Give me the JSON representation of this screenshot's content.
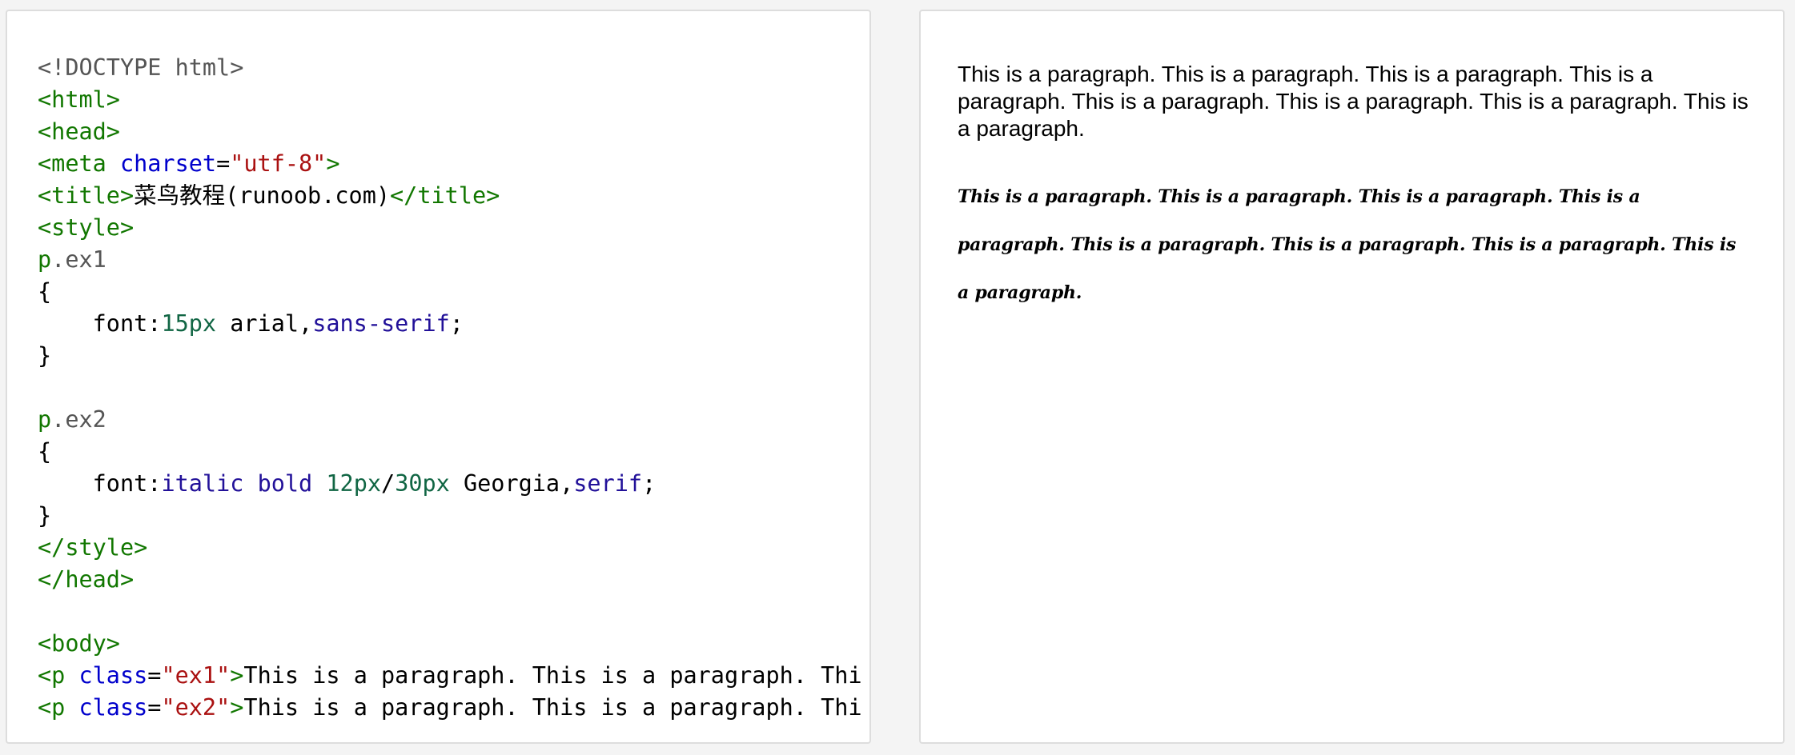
{
  "code_editor": {
    "lines": [
      [
        {
          "c": "d",
          "t": "<!DOCTYPE html>"
        }
      ],
      [
        {
          "c": "t",
          "t": "<html>"
        }
      ],
      [
        {
          "c": "t",
          "t": "<head>"
        }
      ],
      [
        {
          "c": "t",
          "t": "<meta "
        },
        {
          "c": "a",
          "t": "charset"
        },
        {
          "c": "x",
          "t": "="
        },
        {
          "c": "s",
          "t": "\"utf-8\""
        },
        {
          "c": "t",
          "t": ">"
        }
      ],
      [
        {
          "c": "t",
          "t": "<title>"
        },
        {
          "c": "x",
          "t": "菜鸟教程(runoob.com)"
        },
        {
          "c": "t",
          "t": "</title>"
        }
      ],
      [
        {
          "c": "t",
          "t": "<style>"
        }
      ],
      [
        {
          "c": "t",
          "t": "p"
        },
        {
          "c": "p",
          "t": ".ex1"
        }
      ],
      [
        {
          "c": "x",
          "t": "{"
        }
      ],
      [
        {
          "c": "x",
          "t": "    font:"
        },
        {
          "c": "n",
          "t": "15px"
        },
        {
          "c": "x",
          "t": " arial,"
        },
        {
          "c": "k",
          "t": "sans-serif"
        },
        {
          "c": "x",
          "t": ";"
        }
      ],
      [
        {
          "c": "x",
          "t": "}"
        }
      ],
      [],
      [
        {
          "c": "t",
          "t": "p"
        },
        {
          "c": "p",
          "t": ".ex2"
        }
      ],
      [
        {
          "c": "x",
          "t": "{"
        }
      ],
      [
        {
          "c": "x",
          "t": "    font:"
        },
        {
          "c": "k",
          "t": "italic"
        },
        {
          "c": "x",
          "t": " "
        },
        {
          "c": "k",
          "t": "bold"
        },
        {
          "c": "x",
          "t": " "
        },
        {
          "c": "n",
          "t": "12px"
        },
        {
          "c": "x",
          "t": "/"
        },
        {
          "c": "n",
          "t": "30px"
        },
        {
          "c": "x",
          "t": " Georgia,"
        },
        {
          "c": "k",
          "t": "serif"
        },
        {
          "c": "x",
          "t": ";"
        }
      ],
      [
        {
          "c": "x",
          "t": "}"
        }
      ],
      [
        {
          "c": "t",
          "t": "</style>"
        }
      ],
      [
        {
          "c": "t",
          "t": "</head>"
        }
      ],
      [],
      [
        {
          "c": "t",
          "t": "<body>"
        }
      ],
      [
        {
          "c": "t",
          "t": "<p "
        },
        {
          "c": "a",
          "t": "class"
        },
        {
          "c": "x",
          "t": "="
        },
        {
          "c": "s",
          "t": "\"ex1\""
        },
        {
          "c": "t",
          "t": ">"
        },
        {
          "c": "x",
          "t": "This is a paragraph. This is a paragraph. Thi"
        }
      ],
      [
        {
          "c": "t",
          "t": "<p "
        },
        {
          "c": "a",
          "t": "class"
        },
        {
          "c": "x",
          "t": "="
        },
        {
          "c": "s",
          "t": "\"ex2\""
        },
        {
          "c": "t",
          "t": ">"
        },
        {
          "c": "x",
          "t": "This is a paragraph. This is a paragraph. Thi"
        }
      ]
    ]
  },
  "result": {
    "p_ex1": "This is a paragraph. This is a paragraph. This is a paragraph. This is a paragraph. This is a paragraph. This is a paragraph. This is a paragraph. This is a paragraph.",
    "p_ex2": "This is a paragraph. This is a paragraph. This is a paragraph. This is a paragraph. This is a paragraph. This is a paragraph. This is a paragraph. This is a paragraph."
  }
}
